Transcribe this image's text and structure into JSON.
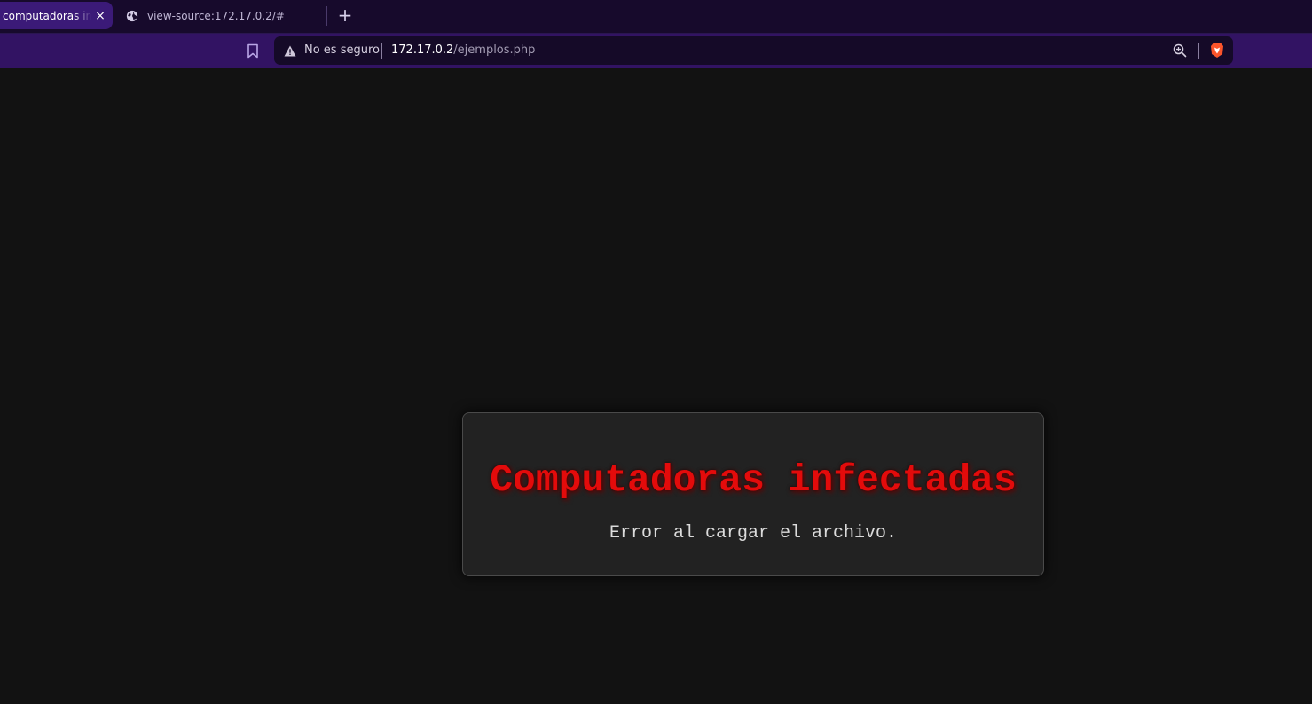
{
  "tabs": [
    {
      "title": "computadoras infectadas",
      "active": true,
      "close_label": "×"
    },
    {
      "title": "view-source:172.17.0.2/#",
      "active": false,
      "icon": "globe-icon"
    }
  ],
  "new_tab_label": "+",
  "toolbar": {
    "security_label": "No es seguro",
    "url_host": "172.17.0.2",
    "url_path": "/ejemplos.php",
    "icons": [
      "bookmark-icon",
      "warning-icon",
      "zoom-icon",
      "brave-shield-icon"
    ]
  },
  "page": {
    "title": "Computadoras infectadas",
    "message": "Error al cargar el archivo."
  },
  "colors": {
    "tabbar_bg": "#170a2c",
    "active_tab_bg": "#3b1a78",
    "toolbar_bg": "#321363",
    "omnibox_bg": "#150a28",
    "page_bg": "#121212",
    "card_bg": "#222222",
    "title_red": "#e30b0b",
    "message_text": "#dcdcdc",
    "brave_orange": "#fb542b"
  }
}
